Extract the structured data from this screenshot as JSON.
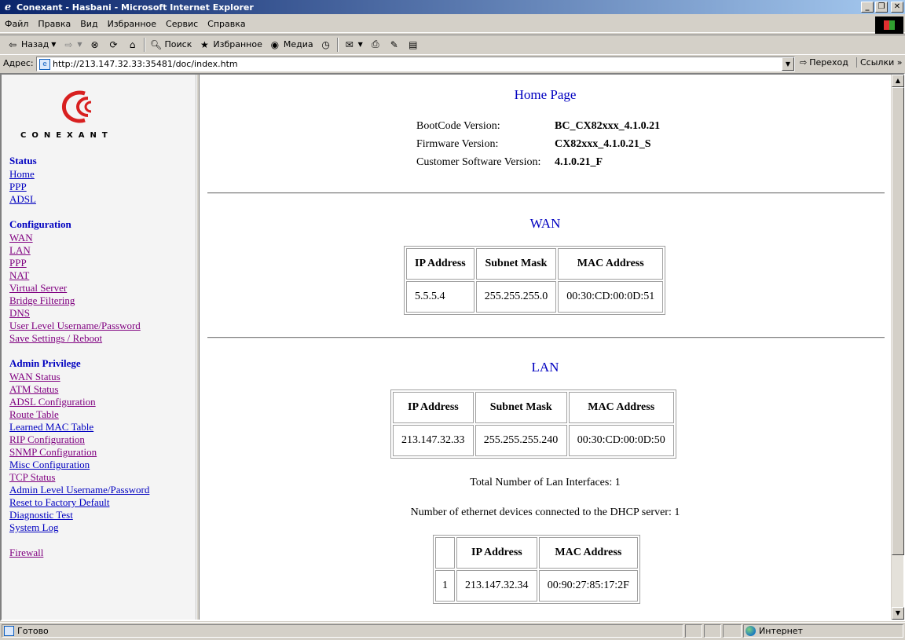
{
  "window": {
    "title": "Conexant - Hasbani - Microsoft Internet Explorer",
    "minimize": "_",
    "maximize": "❐",
    "close": "✕"
  },
  "menu": [
    "Файл",
    "Правка",
    "Вид",
    "Избранное",
    "Сервис",
    "Справка"
  ],
  "toolbar": {
    "back": "Назад",
    "search": "Поиск",
    "favorites": "Избранное",
    "media": "Медиа"
  },
  "address": {
    "label": "Адрес:",
    "url": "http://213.147.32.33:35481/doc/index.htm",
    "go": "Переход",
    "links": "Ссылки"
  },
  "sidebar": {
    "brand": "CONEXANT",
    "sections": [
      {
        "title": "Status",
        "links": [
          "Home",
          "PPP",
          "ADSL"
        ]
      },
      {
        "title": "Configuration",
        "links": [
          "WAN",
          "LAN",
          "PPP",
          "NAT",
          "Virtual Server",
          "Bridge Filtering",
          "DNS",
          "User Level Username/Password",
          "Save Settings / Reboot"
        ]
      },
      {
        "title": "Admin Privilege",
        "links": [
          "WAN Status",
          "ATM Status",
          "ADSL Configuration",
          "Route Table",
          "Learned MAC Table",
          "RIP Configuration",
          "SNMP Configuration",
          "Misc Configuration",
          "TCP Status",
          "Admin Level Username/Password",
          "Reset to Factory Default",
          "Diagnostic Test",
          "System Log"
        ]
      }
    ],
    "firewall": "Firewall"
  },
  "main": {
    "title": "Home Page",
    "versions": [
      {
        "label": "BootCode Version:",
        "value": "BC_CX82xxx_4.1.0.21"
      },
      {
        "label": "Firmware Version:",
        "value": "CX82xxx_4.1.0.21_S"
      },
      {
        "label": "Customer Software Version:",
        "value": "4.1.0.21_F"
      }
    ],
    "wan": {
      "title": "WAN",
      "headers": [
        "IP Address",
        "Subnet Mask",
        "MAC Address"
      ],
      "row": [
        "5.5.5.4",
        "255.255.255.0",
        "00:30:CD:00:0D:51"
      ]
    },
    "lan": {
      "title": "LAN",
      "headers": [
        "IP Address",
        "Subnet Mask",
        "MAC Address"
      ],
      "row": [
        "213.147.32.33",
        "255.255.255.240",
        "00:30:CD:00:0D:50"
      ],
      "total_interfaces": "Total Number of Lan Interfaces: 1",
      "dhcp_devices": "Number of ethernet devices connected to the DHCP server: 1"
    },
    "dhcp": {
      "headers": [
        "",
        "IP Address",
        "MAC Address"
      ],
      "row": [
        "1",
        "213.147.32.34",
        "00:90:27:85:17:2F"
      ]
    }
  },
  "status": {
    "text": "Готово",
    "zone": "Интернет"
  }
}
